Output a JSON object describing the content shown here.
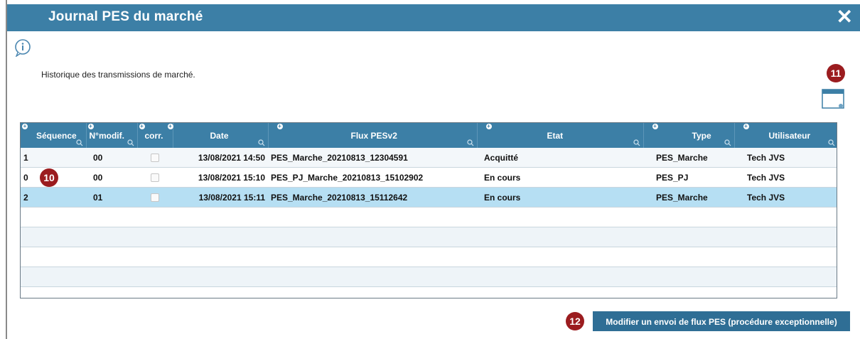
{
  "dialog": {
    "title": "Journal PES du marché",
    "close_label": "✕"
  },
  "info_text": "Historique des transmissions de marché.",
  "badges": {
    "b10": "10",
    "b11": "11",
    "b12": "12"
  },
  "table": {
    "headers": [
      "Séquence",
      "N°modif.",
      "corr.",
      "Date",
      "Flux PESv2",
      "Etat",
      "Type",
      "Utilisateur"
    ],
    "rows": [
      {
        "seq": "1",
        "modif": "00",
        "date": "13/08/2021 14:50",
        "flux": "PES_Marche_20210813_12304591",
        "etat": "Acquitté",
        "type": "PES_Marche",
        "user": "Tech JVS"
      },
      {
        "seq": "0",
        "modif": "00",
        "date": "13/08/2021 15:10",
        "flux": "PES_PJ_Marche_20210813_15102902",
        "etat": "En cours",
        "type": "PES_PJ",
        "user": "Tech JVS"
      },
      {
        "seq": "2",
        "modif": "01",
        "date": "13/08/2021 15:11",
        "flux": "PES_Marche_20210813_15112642",
        "etat": "En cours",
        "type": "PES_Marche",
        "user": "Tech JVS"
      }
    ]
  },
  "action_button": "Modifier un envoi de flux PES (procédure exceptionnelle)",
  "colors": {
    "header": "#3c7fa6",
    "selected_row": "#b6dff3",
    "badge": "#9b1c1f"
  }
}
